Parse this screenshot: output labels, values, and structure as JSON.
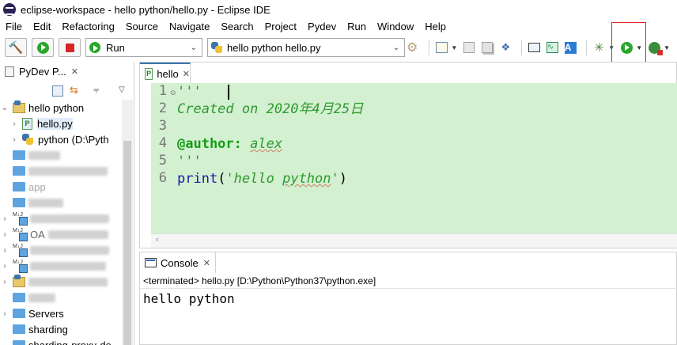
{
  "window": {
    "title": "eclipse-workspace - hello python/hello.py - Eclipse IDE"
  },
  "menu": [
    "File",
    "Edit",
    "Refactoring",
    "Source",
    "Navigate",
    "Search",
    "Project",
    "Pydev",
    "Run",
    "Window",
    "Help"
  ],
  "toolbar": {
    "run_combo": "Run",
    "launch_combo": "hello python hello.py"
  },
  "explorer": {
    "tab_label": "PyDev P...",
    "tree": [
      {
        "label": "hello python",
        "kind": "project",
        "expanded": true
      },
      {
        "label": "hello.py",
        "kind": "file",
        "selected": true
      },
      {
        "label": "python  (D:\\Pyth",
        "kind": "interpreter"
      },
      {
        "label": "",
        "kind": "folder-redacted"
      },
      {
        "label": "",
        "kind": "folder-redacted"
      },
      {
        "label": "app",
        "kind": "folder-redacted"
      },
      {
        "label": "",
        "kind": "folder-redacted"
      },
      {
        "label": "",
        "kind": "maven-redacted"
      },
      {
        "label": "OA",
        "kind": "maven-redacted"
      },
      {
        "label": "",
        "kind": "maven-redacted"
      },
      {
        "label": "",
        "kind": "maven-redacted"
      },
      {
        "label": "",
        "kind": "folder-redacted"
      },
      {
        "label": "",
        "kind": "folder-redacted"
      },
      {
        "label": "Servers",
        "kind": "folder"
      },
      {
        "label": "sharding",
        "kind": "folder"
      },
      {
        "label": "sharding-proxy-de",
        "kind": "folder"
      }
    ]
  },
  "editor": {
    "tab_label": "hello",
    "line_numbers": [
      "1",
      "2",
      "3",
      "4",
      "5",
      "6"
    ],
    "lines": {
      "l1": "'''",
      "l2": "Created on 2020年4月25日",
      "l4_key": "@author:",
      "l4_val": "alex",
      "l5": "'''",
      "l6_fn": "print",
      "l6_open": "(",
      "l6_str_pre": "'hello ",
      "l6_str_word": "python",
      "l6_str_post": "'",
      "l6_close": ")"
    }
  },
  "console": {
    "tab_label": "Console",
    "status": "<terminated> hello.py [D:\\Python\\Python37\\python.exe]",
    "output": "hello python"
  },
  "colors": {
    "editor_bg": "#d3f0d1",
    "comment_green": "#2f9a2f",
    "keyword_blue": "#1a1aa6",
    "highlight_red": "#e0262a"
  }
}
